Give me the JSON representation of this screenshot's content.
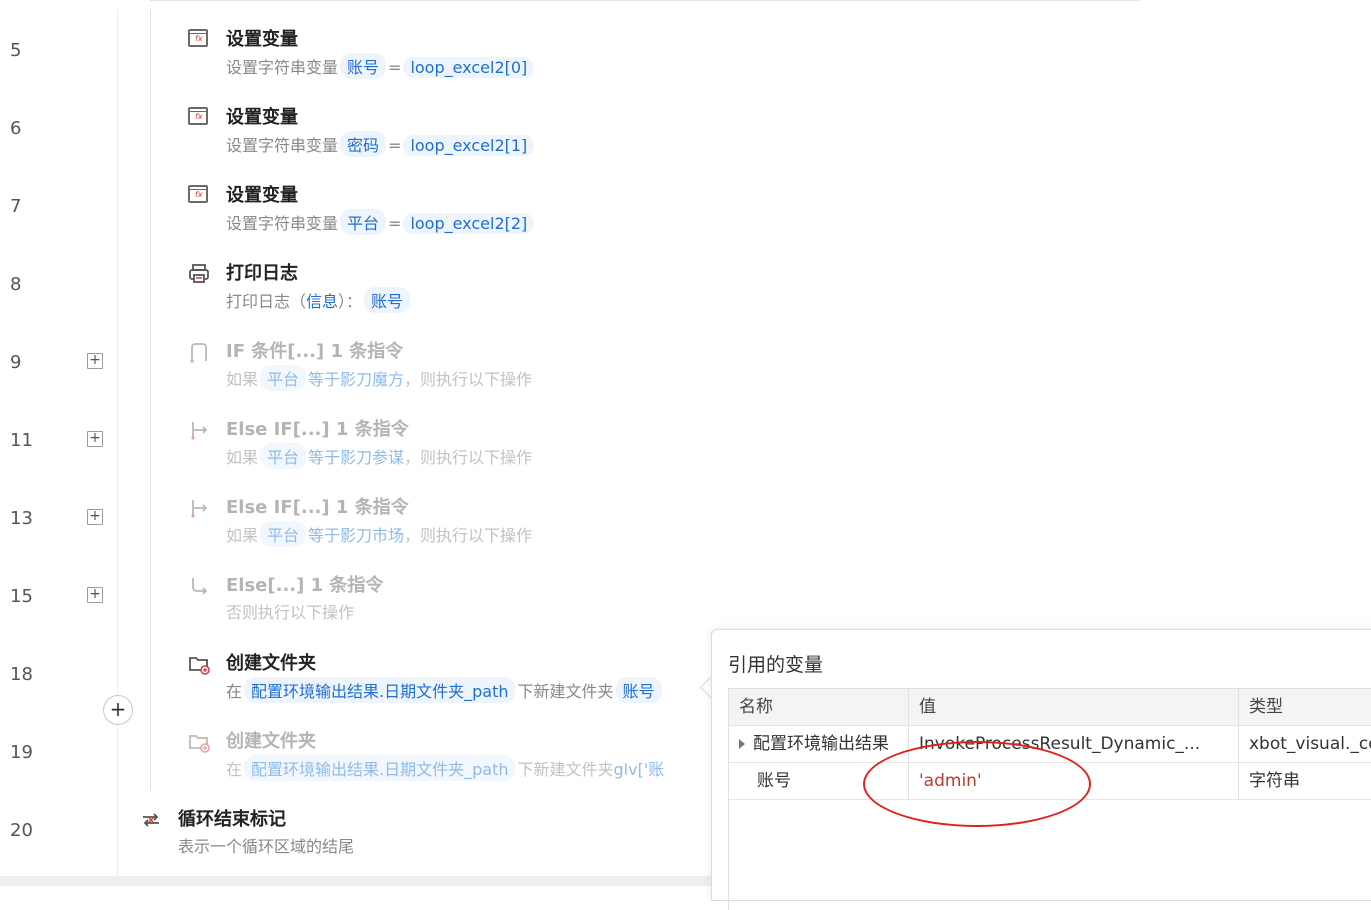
{
  "lines": [
    {
      "no": "5"
    },
    {
      "no": "6"
    },
    {
      "no": "7"
    },
    {
      "no": "8"
    },
    {
      "no": "9"
    },
    {
      "no": "11"
    },
    {
      "no": "13"
    },
    {
      "no": "15"
    },
    {
      "no": "18"
    },
    {
      "no": "19"
    },
    {
      "no": "20"
    }
  ],
  "steps": {
    "s5": {
      "title": "设置变量",
      "desc_prefix": "设置字符串变量",
      "var": "账号",
      "eq": "=",
      "value": "loop_excel2[0]"
    },
    "s6": {
      "title": "设置变量",
      "desc_prefix": "设置字符串变量",
      "var": "密码",
      "eq": "=",
      "value": "loop_excel2[1]"
    },
    "s7": {
      "title": "设置变量",
      "desc_prefix": "设置字符串变量",
      "var": "平台",
      "eq": "=",
      "value": "loop_excel2[2]"
    },
    "s8": {
      "title": "打印日志",
      "desc_prefix": "打印日志（",
      "param": "信息",
      "desc_mid": "）：",
      "var": "账号"
    },
    "s9": {
      "title": "IF 条件[...]",
      "count": "1 条指令",
      "desc_prefix": "如果",
      "var": "平台",
      "cond": "等于影刀魔方",
      "desc_suffix": "，则执行以下操作"
    },
    "s11": {
      "title": "Else IF[...]",
      "count": "1 条指令",
      "desc_prefix": "如果",
      "var": "平台",
      "cond": "等于影刀参谋",
      "desc_suffix": "，则执行以下操作"
    },
    "s13": {
      "title": "Else IF[...]",
      "count": "1 条指令",
      "desc_prefix": "如果",
      "var": "平台",
      "cond": "等于影刀市场",
      "desc_suffix": "，则执行以下操作"
    },
    "s15": {
      "title": "Else[...]",
      "count": "1 条指令",
      "desc": "否则执行以下操作"
    },
    "s18": {
      "title": "创建文件夹",
      "desc_prefix": "在",
      "path": "配置环境输出结果.日期文件夹_path",
      "desc_mid": "下新建文件夹",
      "var": "账号"
    },
    "s19": {
      "title": "创建文件夹",
      "desc_prefix": "在",
      "path": "配置环境输出结果.日期文件夹_path",
      "desc_mid": "下新建文件夹",
      "var": "glv['账"
    },
    "s20": {
      "title": "循环结束标记",
      "desc": "表示一个循环区域的结尾"
    }
  },
  "popup": {
    "title": "引用的变量",
    "columns": [
      "名称",
      "值",
      "类型"
    ],
    "rows": [
      {
        "name": "配置环境输出结果",
        "value": "InvokeProcessResult_Dynamic_...",
        "type": "xbot_visual._co"
      },
      {
        "name": "账号",
        "value": "'admin'",
        "type": "字符串"
      }
    ]
  },
  "colors": {
    "accent": "#1f6fd1",
    "annotation": "#e02020",
    "string_value": "#c0392b"
  }
}
